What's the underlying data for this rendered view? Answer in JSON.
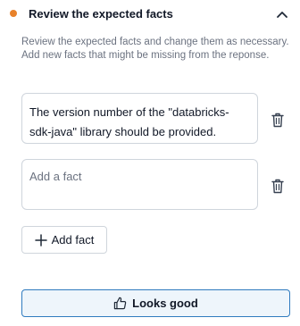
{
  "header": {
    "title": "Review the expected facts",
    "status_color": "#e8822a",
    "collapse_icon": "chevron-up-icon"
  },
  "description": "Review the expected facts and change them as necessary. Add new facts that might be missing from the reponse.",
  "facts": [
    {
      "text": "The version number of the \"databricks-sdk-java\" library should be provided.",
      "delete_icon": "trash-icon"
    }
  ],
  "new_fact": {
    "value": "",
    "placeholder": "Add a fact",
    "delete_icon": "trash-icon"
  },
  "add_fact_button": {
    "label": "Add fact",
    "icon": "plus-icon"
  },
  "looks_good_button": {
    "label": "Looks good",
    "icon": "thumbs-up-icon",
    "border_color": "#2f7bbf",
    "background": "#eef5fb"
  }
}
